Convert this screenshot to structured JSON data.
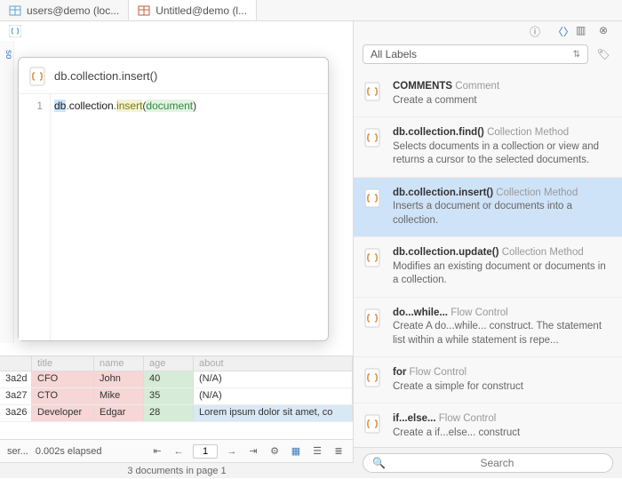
{
  "tabs": [
    {
      "label": "users@demo (loc...",
      "color": "#5aa7d6"
    },
    {
      "label": "Untitled@demo (l...",
      "color": "#c45a3a"
    }
  ],
  "sidebar_hint": "so",
  "popup": {
    "title": "db.collection.insert()",
    "line_no": "1",
    "code": {
      "obj": "db",
      "coll": "collection",
      "method": "insert",
      "arg": "document"
    }
  },
  "grid": {
    "headers": [
      "",
      "title",
      "name",
      "age",
      "about"
    ],
    "rows": [
      {
        "id": "3a2d",
        "title": "CFO",
        "name": "John",
        "age": "40",
        "about": "(N/A)"
      },
      {
        "id": "3a27",
        "title": "CTO",
        "name": "Mike",
        "age": "35",
        "about": "(N/A)"
      },
      {
        "id": "3a26",
        "title": "Developer",
        "name": "Edgar",
        "age": "28",
        "about": "Lorem ipsum dolor sit amet, co"
      }
    ]
  },
  "footer": {
    "ser": "ser...",
    "elapsed": "0.002s elapsed",
    "page": "1"
  },
  "status": "3 documents in page 1",
  "right": {
    "labels": "All Labels",
    "search_placeholder": "Search",
    "items": [
      {
        "title": "COMMENTS",
        "type": "Comment",
        "desc": "Create a comment"
      },
      {
        "title": "db.collection.find()",
        "type": "Collection Method",
        "desc": "Selects documents in a collection or view and returns a cursor to the selected documents."
      },
      {
        "title": "db.collection.insert()",
        "type": "Collection Method",
        "desc": "Inserts a document or documents into a collection.",
        "selected": true
      },
      {
        "title": "db.collection.update()",
        "type": "Collection Method",
        "desc": "Modifies an existing document or documents in a collection."
      },
      {
        "title": "do...while...",
        "type": "Flow Control",
        "desc": "Create A do...while... construct. The statement list within a while statement is repe..."
      },
      {
        "title": "for",
        "type": "Flow Control",
        "desc": "Create a simple for construct"
      },
      {
        "title": "if...else...",
        "type": "Flow Control",
        "desc": "Create a if...else... construct"
      }
    ]
  }
}
